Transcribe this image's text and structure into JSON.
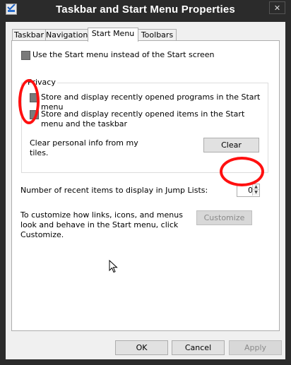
{
  "window": {
    "title": "Taskbar and Start Menu Properties",
    "close_glyph": "✕"
  },
  "tabs": [
    {
      "label": "Taskbar",
      "active": false
    },
    {
      "label": "Navigation",
      "active": false
    },
    {
      "label": "Start Menu",
      "active": true
    },
    {
      "label": "Toolbars",
      "active": false
    }
  ],
  "start_menu": {
    "use_start_menu_label": "Use the Start menu instead of the Start screen",
    "use_start_menu_checked": false,
    "privacy": {
      "legend": "Privacy",
      "recent_programs_label": "Store and display recently opened programs in the Start menu",
      "recent_programs_checked": false,
      "recent_items_label": "Store and display recently opened items in the Start menu and the taskbar",
      "recent_items_checked": false,
      "clear_label": "Clear personal info from my tiles.",
      "clear_button": "Clear"
    },
    "jump_lists": {
      "label": "Number of recent items to display in Jump Lists:",
      "value": "0"
    },
    "customize": {
      "text": "To customize how links, icons, and menus look and behave in the Start menu, click Customize.",
      "button": "Customize"
    }
  },
  "footer": {
    "ok": "OK",
    "cancel": "Cancel",
    "apply": "Apply"
  },
  "annotation_color": "#ff1010"
}
